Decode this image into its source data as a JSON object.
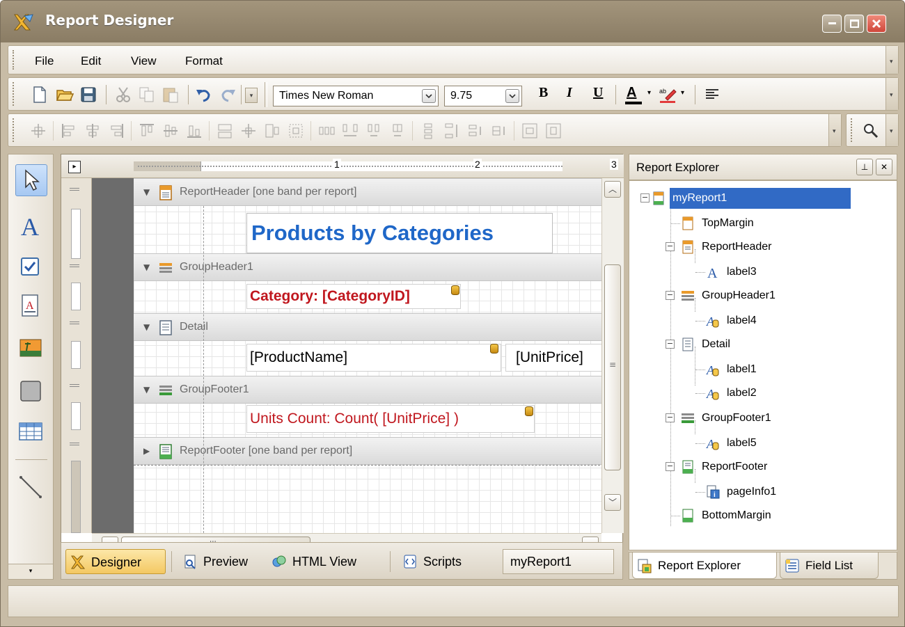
{
  "window": {
    "title": "Report Designer",
    "title_icon": "report-designer-logo-icon",
    "controls": [
      "minimize-icon",
      "maximize-icon",
      "close-icon"
    ]
  },
  "menu": {
    "items": [
      "File",
      "Edit",
      "View",
      "Format"
    ]
  },
  "toolbar": {
    "font_name": "Times New Roman",
    "font_size": "9.75",
    "bold_label": "B",
    "italic_label": "I",
    "underline_label": "U",
    "forecolor_label": "A",
    "icons": [
      "new-file-icon",
      "open-folder-icon",
      "save-icon",
      "cut-icon",
      "copy-icon",
      "paste-icon",
      "undo-icon",
      "redo-icon",
      "bold-icon",
      "italic-icon",
      "underline-icon",
      "font-color-icon",
      "highlight-color-icon",
      "align-left-icon",
      "zoom-icon"
    ]
  },
  "toolbox": {
    "items": [
      "pointer-icon",
      "label-icon",
      "checkbox-icon",
      "richtext-icon",
      "picture-icon",
      "panel-icon",
      "table-icon",
      "line-icon"
    ]
  },
  "designer": {
    "ruler_marks": [
      "1",
      "2",
      "3"
    ],
    "bands": [
      {
        "name": "ReportHeader [one band per report]",
        "expanded": true
      },
      {
        "name": "GroupHeader1",
        "expanded": true
      },
      {
        "name": "Detail",
        "expanded": true
      },
      {
        "name": "GroupFooter1",
        "expanded": true
      },
      {
        "name": "ReportFooter [one band per report]",
        "expanded": false
      }
    ],
    "labels": {
      "title": "Products by Categories",
      "category": "Category: [CategoryID]",
      "product_name": "[ProductName]",
      "unit_price": "[UnitPrice]",
      "units_count": "Units Count: Count( [UnitPrice] )"
    },
    "colors": {
      "title": "#1f67c8",
      "category": "#c0171e",
      "units_count": "#c0171e",
      "selection": "#316ac5"
    },
    "hscroll_mark": "III"
  },
  "view_tabs": {
    "designer": "Designer",
    "preview": "Preview",
    "html_view": "HTML View",
    "scripts": "Scripts",
    "report_name": "myReport1"
  },
  "explorer": {
    "title": "Report Explorer",
    "tree": [
      {
        "label": "myReport1",
        "level": 0,
        "selected": true
      },
      {
        "label": "TopMargin",
        "level": 1
      },
      {
        "label": "ReportHeader",
        "level": 1
      },
      {
        "label": "label3",
        "level": 2
      },
      {
        "label": "GroupHeader1",
        "level": 1
      },
      {
        "label": "label4",
        "level": 2
      },
      {
        "label": "Detail",
        "level": 1
      },
      {
        "label": "label1",
        "level": 2
      },
      {
        "label": "label2",
        "level": 2
      },
      {
        "label": "GroupFooter1",
        "level": 1
      },
      {
        "label": "label5",
        "level": 2
      },
      {
        "label": "ReportFooter",
        "level": 1
      },
      {
        "label": "pageInfo1",
        "level": 2
      },
      {
        "label": "BottomMargin",
        "level": 1
      }
    ],
    "tabs": {
      "report_explorer": "Report Explorer",
      "field_list": "Field List"
    }
  }
}
